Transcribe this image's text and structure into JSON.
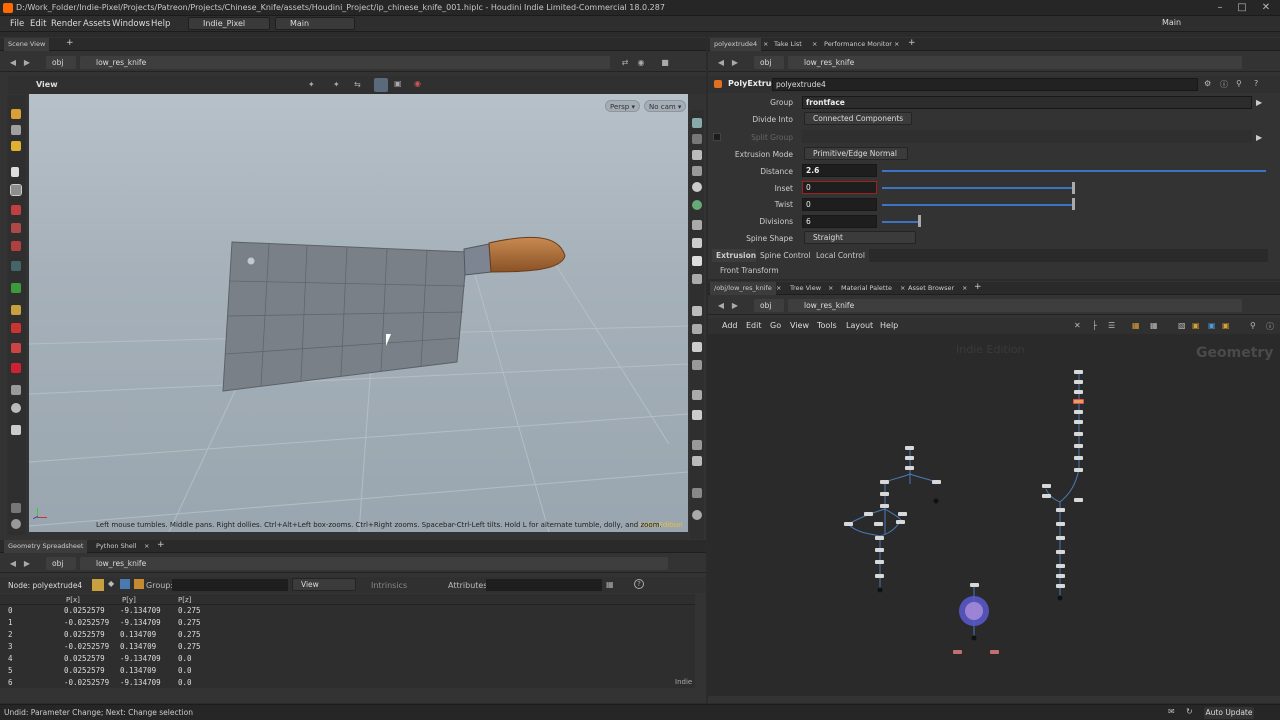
{
  "window": {
    "title": "D:/Work_Folder/Indie-Pixel/Projects/Patreon/Projects/Chinese_Knife/assets/Houdini_Project/ip_chinese_knife_001.hiplc - Houdini Indie Limited-Commercial 18.0.287"
  },
  "menu": [
    "File",
    "Edit",
    "Render",
    "Assets",
    "Windows",
    "Help"
  ],
  "desktop": {
    "name": "Indie_Pixel",
    "workspace": "Main",
    "right_workspace": "Main"
  },
  "scene": {
    "tab_label": "Scene View",
    "path_obj": "obj",
    "path_node": "low_res_knife",
    "view_label": "View",
    "persp_btn": "Persp ▾",
    "cam_btn": "No cam ▾",
    "hint": "Left mouse tumbles. Middle pans. Right dollies. Ctrl+Alt+Left box-zooms. Ctrl+Right zooms. Spacebar-Ctrl-Left tilts. Hold L for alternate tumble, dolly, and zoom.",
    "edition": "Indie Edition"
  },
  "params": {
    "tabs": [
      "polyextrude4",
      "Take List",
      "Performance Monitor"
    ],
    "path_obj": "obj",
    "path_node": "low_res_knife",
    "node_type": "PolyExtrude",
    "node_name": "polyextrude4",
    "rows": {
      "group_label": "Group",
      "group_value": "frontface",
      "divide_label": "Divide Into",
      "divide_value": "Connected Components",
      "split_label": "Split Group",
      "mode_label": "Extrusion Mode",
      "mode_value": "Primitive/Edge Normal",
      "distance_label": "Distance",
      "distance_value": "2.6",
      "inset_label": "Inset",
      "inset_value": "0",
      "twist_label": "Twist",
      "twist_value": "0",
      "div_label": "Divisions",
      "div_value": "6",
      "spine_label": "Spine Shape",
      "spine_value": "Straight"
    },
    "subtabs": [
      "Extrusion",
      "Spine Control",
      "Local Control"
    ],
    "section": "Front Transform"
  },
  "network": {
    "tabs": [
      "/obj/low_res_knife",
      "Tree View",
      "Material Palette",
      "Asset Browser"
    ],
    "path_obj": "obj",
    "path_node": "low_res_knife",
    "menu": [
      "Add",
      "Edit",
      "Go",
      "View",
      "Tools",
      "Layout",
      "Help"
    ],
    "edition": "Indie Edition",
    "context": "Geometry"
  },
  "spreadsheet": {
    "tabs": [
      "Geometry Spreadsheet",
      "Python Shell"
    ],
    "path_obj": "obj",
    "path_node": "low_res_knife",
    "node_label": "Node: polyextrude4",
    "group_label": "Group:",
    "view_label": "View",
    "intrinsics_label": "Intrinsics",
    "attributes_label": "Attributes:",
    "columns": [
      "",
      "P[x]",
      "P[y]",
      "P[z]"
    ],
    "rows": [
      [
        "0",
        "0.0252579",
        "-9.134709",
        "0.275"
      ],
      [
        "1",
        "-0.0252579",
        "-9.134709",
        "0.275"
      ],
      [
        "2",
        "0.0252579",
        "0.134709",
        "0.275"
      ],
      [
        "3",
        "-0.0252579",
        "0.134709",
        "0.275"
      ],
      [
        "4",
        "0.0252579",
        "-9.134709",
        "0.0"
      ],
      [
        "5",
        "0.0252579",
        "0.134709",
        "0.0"
      ],
      [
        "6",
        "-0.0252579",
        "-9.134709",
        "0.0"
      ]
    ],
    "footer": "Indie"
  },
  "status": {
    "message": "Undid: Parameter Change; Next: Change selection",
    "auto_update": "Auto Update"
  }
}
